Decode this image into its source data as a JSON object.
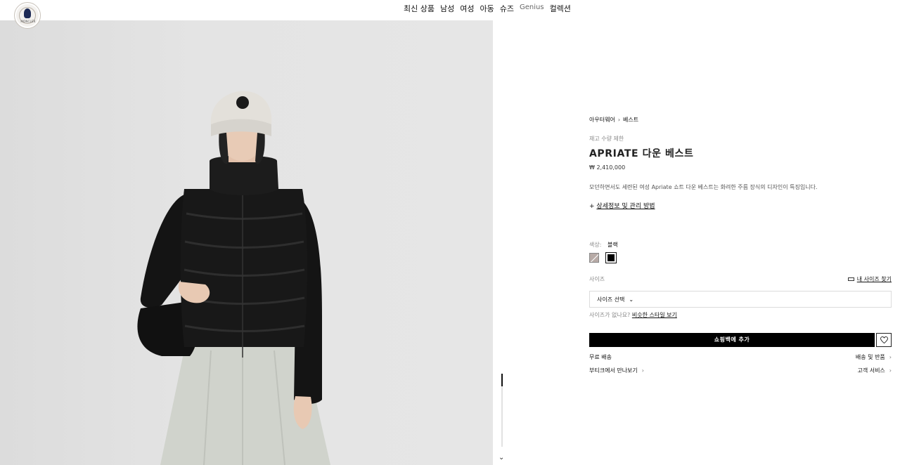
{
  "header": {
    "logo_text": "MONCLER",
    "nav": [
      "최신 상품",
      "남성",
      "여성",
      "아동",
      "슈즈",
      "Genius",
      "컬렉션"
    ]
  },
  "product": {
    "breadcrumb": [
      "아우터웨어",
      "베스트"
    ],
    "stock_note": "재고 수량 제한",
    "title": "APRIATE 다운 베스트",
    "price": "₩ 2,410,000",
    "description": "모던하면서도 세련된 여성 Apriate 쇼트 다운 베스트는 화려한 주름 장식의 디자인이 특징입니다.",
    "details_prefix": "+",
    "details_link": "상세정보 및 관리 방법",
    "color_label": "색상:",
    "color_value": "블랙",
    "colors": [
      {
        "name": "beige",
        "hex": "#b7aaa6"
      },
      {
        "name": "black",
        "hex": "#000000"
      }
    ],
    "size_label": "사이즈",
    "size_guide": "내 사이즈 찾기",
    "size_select": "사이즈 선택",
    "size_help_prefix": "사이즈가 없나요?",
    "size_help_link": "비슷한 스타일 보기",
    "add_to_bag": "쇼핑백에 추가",
    "services": {
      "free_shipping": "무료 배송",
      "shipping_returns": "배송 및 반품",
      "boutique": "부티크에서 만나보기",
      "customer_service": "고객 서비스"
    }
  }
}
